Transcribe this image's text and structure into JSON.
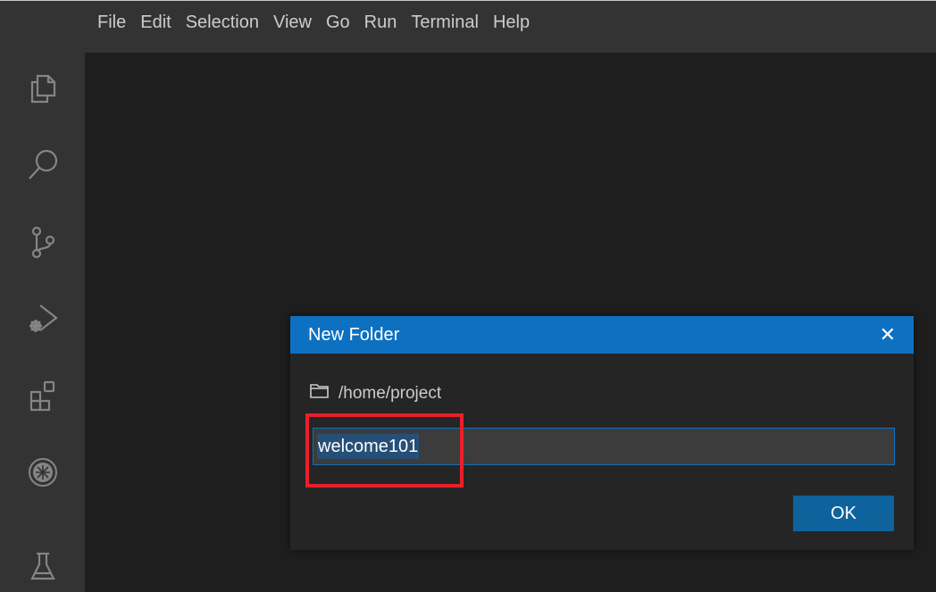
{
  "menubar": {
    "items": [
      "File",
      "Edit",
      "Selection",
      "View",
      "Go",
      "Run",
      "Terminal",
      "Help"
    ]
  },
  "activitybar": {
    "icons": [
      "explorer-icon",
      "search-icon",
      "source-control-icon",
      "run-debug-icon",
      "extensions-icon",
      "plugin-icon",
      "testing-icon"
    ]
  },
  "dialog": {
    "title": "New Folder",
    "close": "✕",
    "path": "/home/project",
    "input_value": "welcome101",
    "ok_label": "OK"
  },
  "colors": {
    "accent": "#0e70c0",
    "button": "#0e639c",
    "selection": "#264f78",
    "highlight": "#e8202a",
    "background": "#1e1e1e",
    "chrome": "#333333"
  }
}
